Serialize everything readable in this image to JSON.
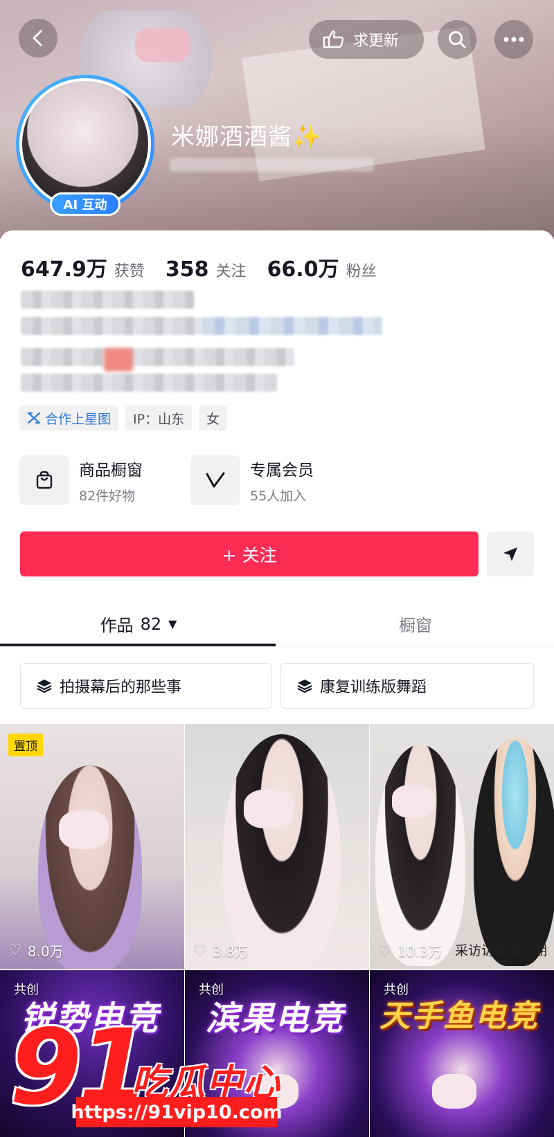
{
  "header": {
    "update_label": "求更新",
    "nickname": "米娜酒酒酱✨",
    "ai_badge": "AI 互动"
  },
  "stats": [
    {
      "num": "647.9万",
      "label": "获赞"
    },
    {
      "num": "358",
      "label": "关注"
    },
    {
      "num": "66.0万",
      "label": "粉丝"
    }
  ],
  "tags": {
    "star": "合作上星图",
    "ip": "IP：山东",
    "gender": "女"
  },
  "features": {
    "shop_title": "商品橱窗",
    "shop_sub": "82件好物",
    "member_title": "专属会员",
    "member_sub": "55人加入"
  },
  "actions": {
    "follow_label": "+ 关注"
  },
  "tabs": {
    "works_label": "作品",
    "works_count": "82",
    "window_label": "橱窗"
  },
  "collections": [
    "拍摄幕后的那些事",
    "康复训练版舞蹈"
  ],
  "videos": [
    {
      "likes": "8.0万",
      "pin": "置顶"
    },
    {
      "likes": "3.8万"
    },
    {
      "likes": "10.3万",
      "caption": "采访访谈第一期"
    },
    {
      "collab": "共创",
      "poster": "锐势电竞"
    },
    {
      "collab": "共创",
      "poster": "滨果电竞"
    },
    {
      "collab": "共创",
      "poster": "天手鱼电竞"
    }
  ],
  "watermark": {
    "big": "91",
    "text": "吃瓜中心",
    "url": "https://91vip10.com"
  },
  "colors": {
    "follow_red": "#fe2c55",
    "ai_blue": "#2f8cff",
    "star_blue": "#2e79d6",
    "pin_yellow": "#ffd600",
    "watermark_red": "#ff1e1e"
  }
}
